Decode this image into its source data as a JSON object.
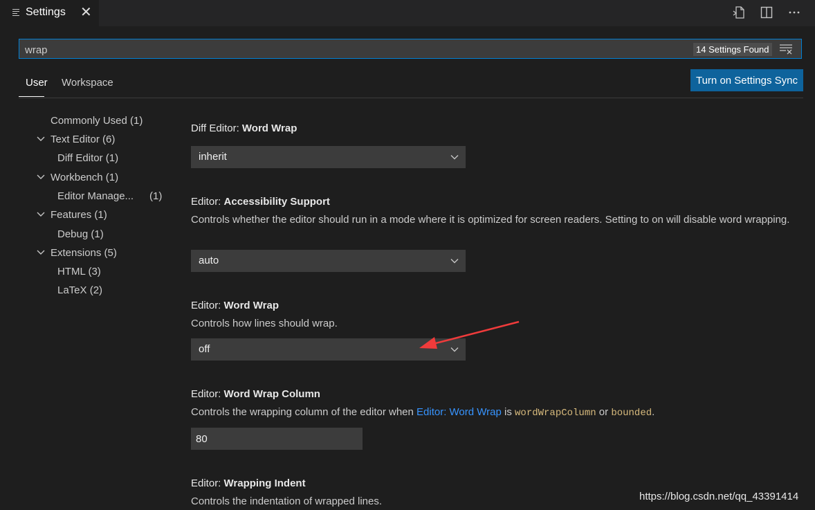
{
  "tab": {
    "title": "Settings",
    "close": "✕"
  },
  "header_actions": [
    "open-settings-json-icon",
    "split-editor-icon",
    "more-actions-icon"
  ],
  "search": {
    "value": "wrap",
    "results_badge": "14 Settings Found"
  },
  "scopes": {
    "user": "User",
    "workspace": "Workspace"
  },
  "sync_button": "Turn on Settings Sync",
  "toc": [
    {
      "label": "Commonly Used",
      "count": "(1)"
    },
    {
      "label": "Text Editor",
      "count": "(6)"
    },
    {
      "label": "Diff Editor",
      "count": "(1)"
    },
    {
      "label": "Workbench",
      "count": "(1)"
    },
    {
      "label": "Editor Manage...",
      "count": "(1)"
    },
    {
      "label": "Features",
      "count": "(1)"
    },
    {
      "label": "Debug",
      "count": "(1)"
    },
    {
      "label": "Extensions",
      "count": "(5)"
    },
    {
      "label": "HTML",
      "count": "(3)"
    },
    {
      "label": "LaTeX",
      "count": "(2)"
    }
  ],
  "settings": {
    "diff_word_wrap": {
      "category": "Diff Editor: ",
      "key": "Word Wrap",
      "value": "inherit"
    },
    "accessibility": {
      "category": "Editor: ",
      "key": "Accessibility Support",
      "description": "Controls whether the editor should run in a mode where it is optimized for screen readers. Setting to on will disable word wrapping.",
      "value": "auto"
    },
    "word_wrap": {
      "category": "Editor: ",
      "key": "Word Wrap",
      "description": "Controls how lines should wrap.",
      "value": "off"
    },
    "word_wrap_column": {
      "category": "Editor: ",
      "key": "Word Wrap Column",
      "desc_before": "Controls the wrapping column of the editor when ",
      "desc_link": "Editor: Word Wrap",
      "desc_is": " is ",
      "desc_code1": "wordWrapColumn",
      "desc_or": " or ",
      "desc_code2": "bounded",
      "desc_end": ".",
      "value": "80"
    },
    "wrapping_indent": {
      "category": "Editor: ",
      "key": "Wrapping Indent",
      "description": "Controls the indentation of wrapped lines."
    }
  },
  "watermark": "https://blog.csdn.net/qq_43391414",
  "colors": {
    "accent": "#007fd4",
    "button": "#0e639c",
    "link": "#3794ff",
    "code": "#d7ba7d",
    "arrow": "#ef3b3b"
  }
}
